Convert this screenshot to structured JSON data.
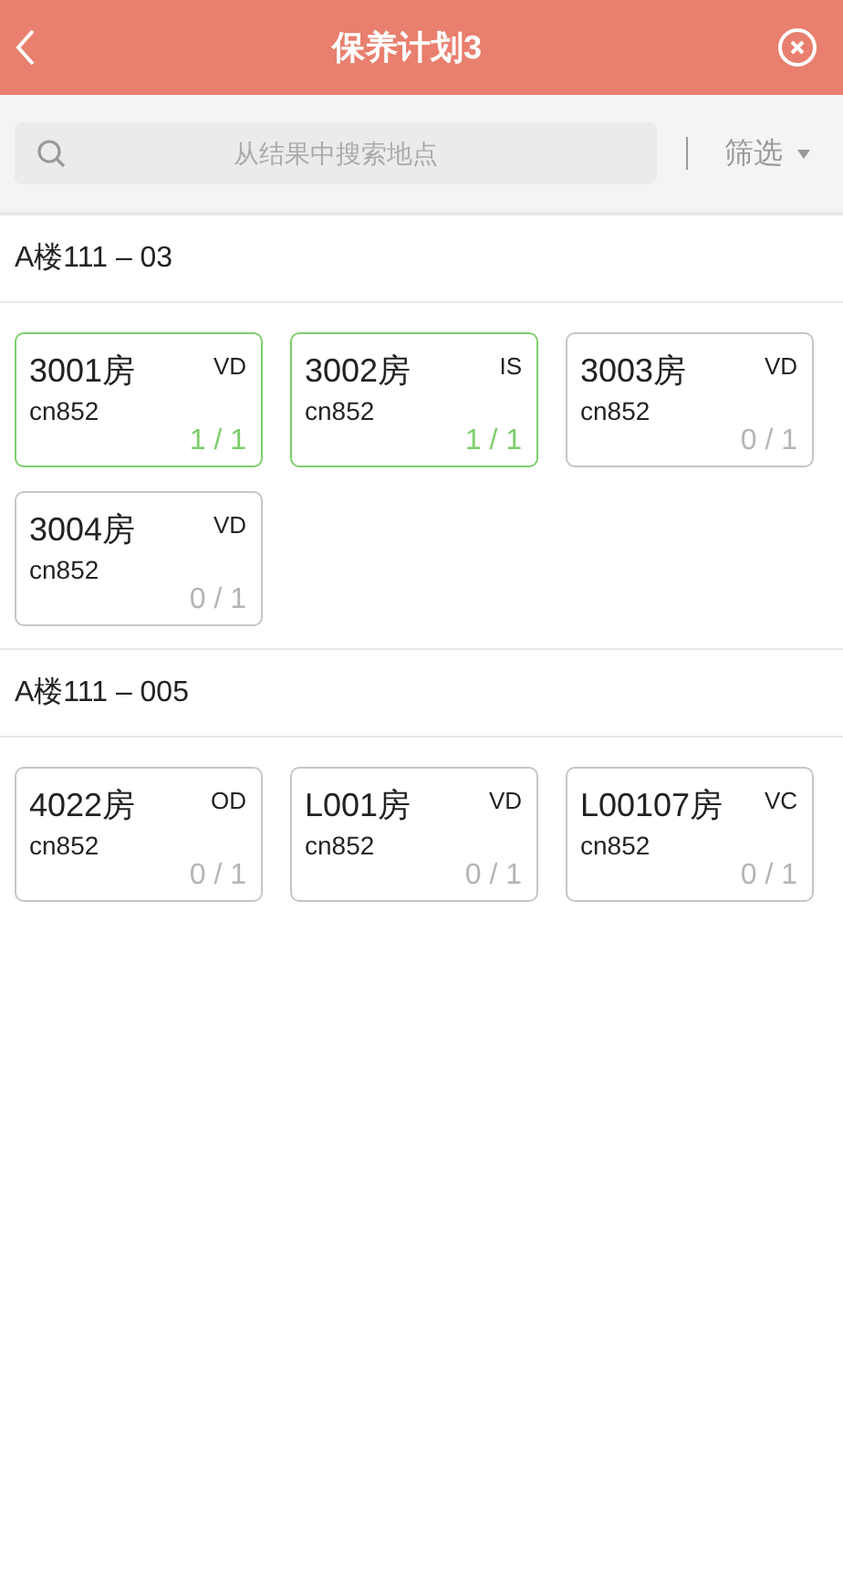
{
  "header": {
    "title": "保养计划3"
  },
  "search": {
    "placeholder": "从结果中搜索地点"
  },
  "filter": {
    "label": "筛选"
  },
  "sections": [
    {
      "title": "A楼111 – 03",
      "rooms": [
        {
          "name": "3001房",
          "status": "VD",
          "code": "cn852",
          "progress": "1 / 1",
          "completed": true
        },
        {
          "name": "3002房",
          "status": "IS",
          "code": "cn852",
          "progress": "1 / 1",
          "completed": true
        },
        {
          "name": "3003房",
          "status": "VD",
          "code": "cn852",
          "progress": "0 / 1",
          "completed": false
        },
        {
          "name": "3004房",
          "status": "VD",
          "code": "cn852",
          "progress": "0 / 1",
          "completed": false
        }
      ]
    },
    {
      "title": "A楼111 – 005",
      "rooms": [
        {
          "name": "4022房",
          "status": "OD",
          "code": "cn852",
          "progress": "0 / 1",
          "completed": false
        },
        {
          "name": "L001房",
          "status": "VD",
          "code": "cn852",
          "progress": "0 / 1",
          "completed": false
        },
        {
          "name": "L00107房",
          "status": "VC",
          "code": "cn852",
          "progress": "0 / 1",
          "completed": false
        }
      ]
    }
  ]
}
